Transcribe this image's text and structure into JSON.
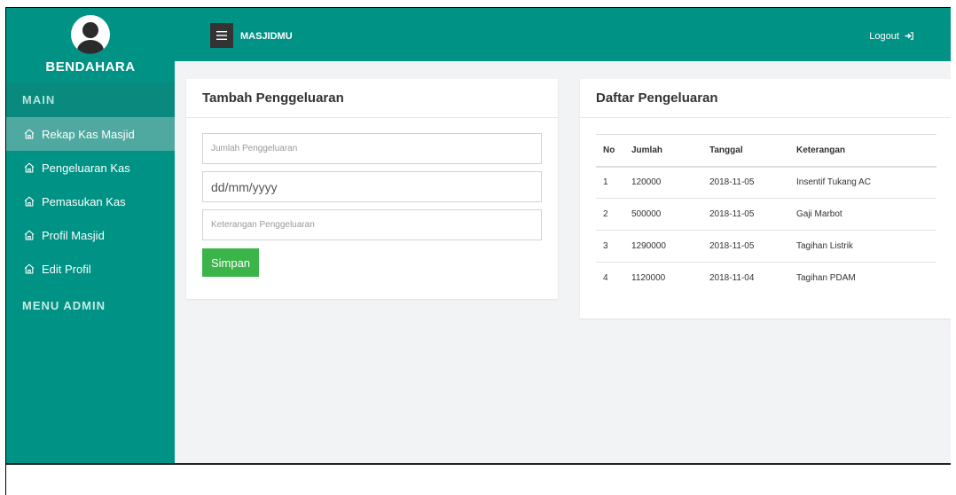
{
  "sidebar": {
    "role": "BENDAHARA",
    "section_main": "MAIN",
    "items": [
      {
        "label": "Rekap Kas Masjid",
        "icon": "home-icon"
      },
      {
        "label": "Pengeluaran Kas",
        "icon": "home-icon"
      },
      {
        "label": "Pemasukan Kas",
        "icon": "home-icon"
      },
      {
        "label": "Profil Masjid",
        "icon": "home-icon"
      },
      {
        "label": "Edit Profil",
        "icon": "home-icon"
      }
    ],
    "section_admin": "MENU ADMIN"
  },
  "topbar": {
    "brand": "MASJIDMU",
    "logout": "Logout"
  },
  "form": {
    "title": "Tambah Penggeluaran",
    "amount_placeholder": "Jumlah Penggeluaran",
    "date_placeholder": "dd/mm/yyyy",
    "note_placeholder": "Keterangan Penggeluaran",
    "save_label": "Simpan"
  },
  "list": {
    "title": "Daftar Pengeluaran",
    "columns": [
      "No",
      "Jumlah",
      "Tanggal",
      "Keterangan"
    ],
    "rows": [
      [
        "1",
        "120000",
        "2018-11-05",
        "Insentif Tukang AC"
      ],
      [
        "2",
        "500000",
        "2018-11-05",
        "Gaji Marbot"
      ],
      [
        "3",
        "1290000",
        "2018-11-05",
        "Tagihan Listrik"
      ],
      [
        "4",
        "1120000",
        "2018-11-04",
        "Tagihan PDAM"
      ]
    ]
  },
  "colors": {
    "primary": "#009285",
    "active_item": "#4fa9a1",
    "save_button": "#3bb44a",
    "background": "#f2f3f5"
  }
}
